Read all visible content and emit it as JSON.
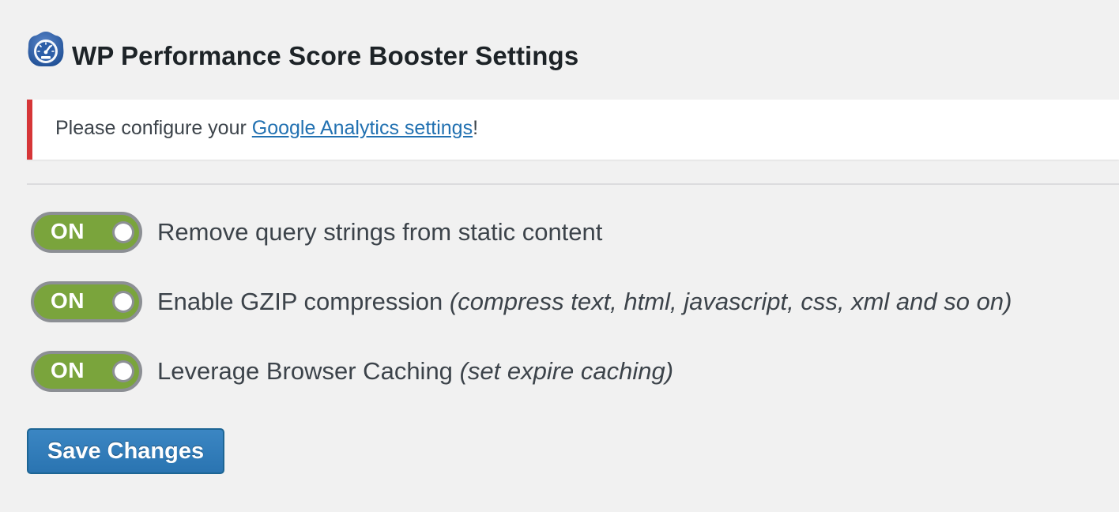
{
  "header": {
    "title": "WP Performance Score Booster Settings",
    "logo_icon": "speedometer-icon"
  },
  "notice": {
    "prefix": "Please configure your ",
    "link_text": "Google Analytics settings",
    "suffix": "!",
    "border_color": "#d63638"
  },
  "settings": {
    "toggle_on_label": "ON",
    "toggle_on_color": "#7aa43c",
    "items": [
      {
        "label": "Remove query strings from static content",
        "note": "",
        "state": "ON"
      },
      {
        "label": "Enable GZIP compression",
        "note": "(compress text, html, javascript, css, xml and so on)",
        "state": "ON"
      },
      {
        "label": "Leverage Browser Caching",
        "note": "(set expire caching)",
        "state": "ON"
      }
    ]
  },
  "actions": {
    "save_label": "Save Changes",
    "button_color": "#2a74b1"
  }
}
